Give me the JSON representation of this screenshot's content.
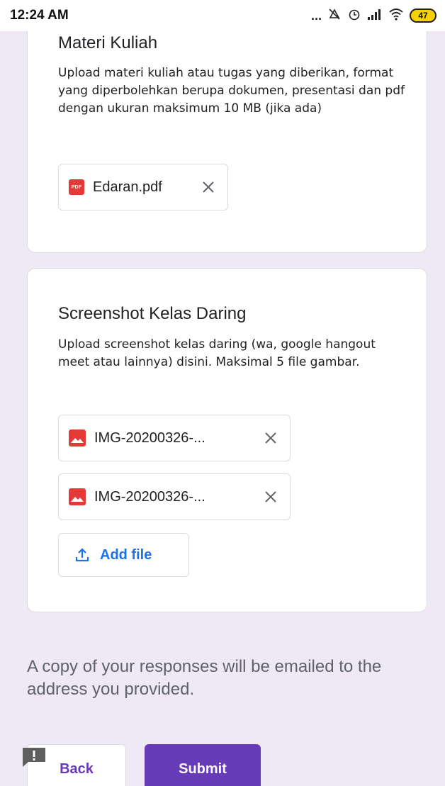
{
  "status_bar": {
    "time": "12:24 AM",
    "dots": "...",
    "battery": "47"
  },
  "questions": [
    {
      "title": "Materi Kuliah",
      "description": "Upload materi kuliah atau tugas yang diberikan, format yang diperbolehkan berupa dokumen, presentasi dan pdf dengan ukuran maksimum 10 MB (jika ada)",
      "files": [
        {
          "name": "Edaran.pdf",
          "icon": "pdf-icon",
          "icon_label": "PDF"
        }
      ]
    },
    {
      "title": "Screenshot Kelas Daring",
      "description": "Upload screenshot kelas daring (wa, google hangout meet atau lainnya) disini. Maksimal 5 file gambar.",
      "files": [
        {
          "name": "IMG-20200326-...",
          "icon": "image-icon"
        },
        {
          "name": "IMG-20200326-...",
          "icon": "image-icon"
        }
      ],
      "add_file_label": "Add file"
    }
  ],
  "footer_note": "A copy of your responses will be emailed to the address you provided.",
  "buttons": {
    "back": "Back",
    "submit": "Submit"
  },
  "colors": {
    "background": "#efe9f6",
    "accent": "#673ab7",
    "link": "#1a73e8",
    "pdf_red": "#e53935"
  }
}
